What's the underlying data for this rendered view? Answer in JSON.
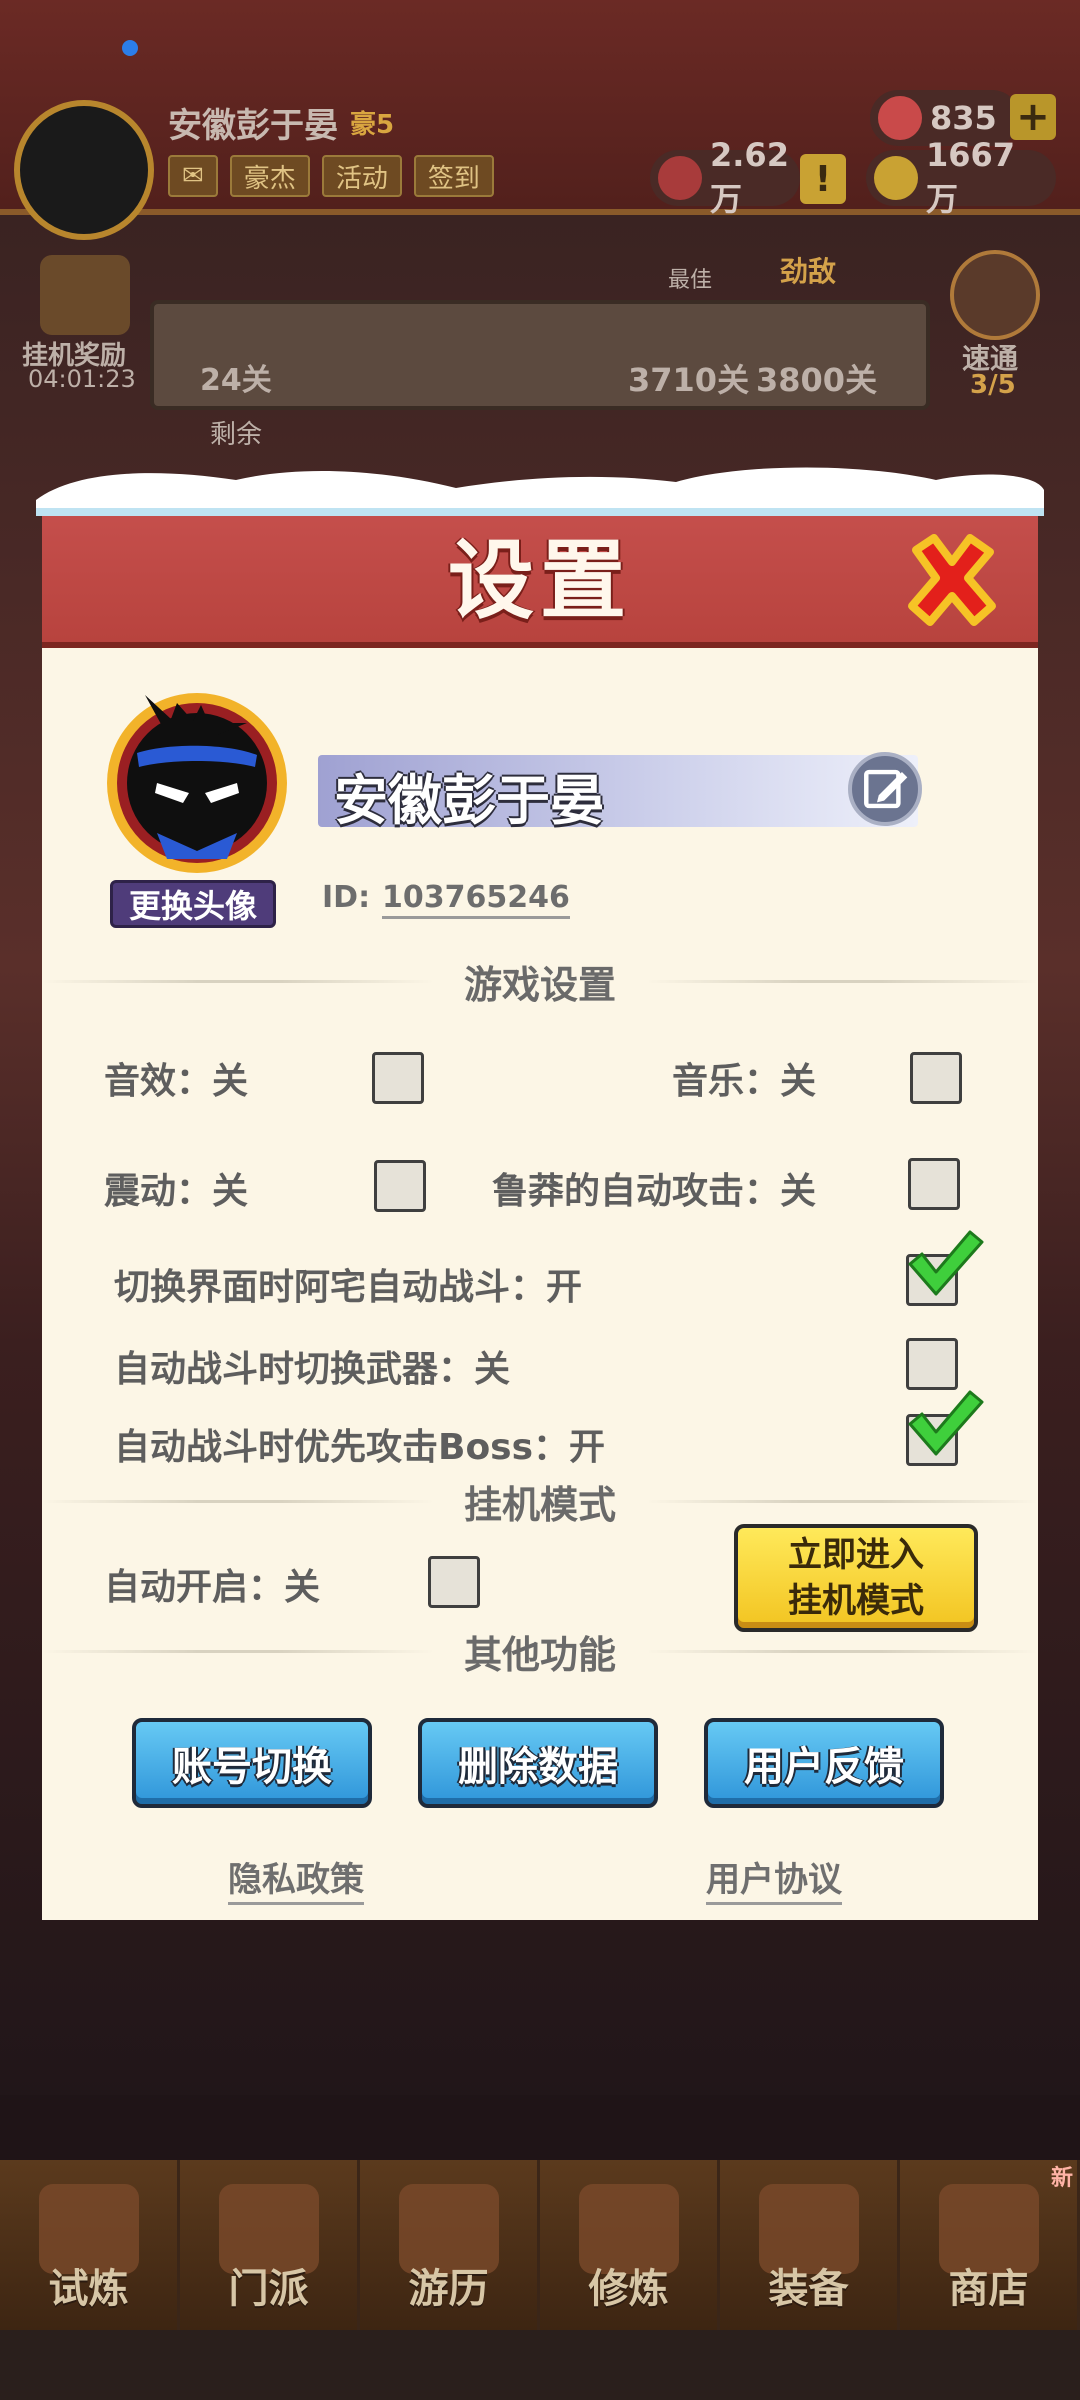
{
  "background": {
    "player_name": "安徽彭于晏",
    "rank": "豪5",
    "chips": [
      "豪杰",
      "活动",
      "签到"
    ],
    "gems": "835",
    "power": "2.62万",
    "coins": "1667万",
    "plus": "+",
    "warn": "!",
    "afk_label": "挂机奖励",
    "afk_timer": "04:01:23",
    "current_stage": "24关",
    "best_label": "最佳",
    "enemy_label": "劲敌",
    "best_stage": "3710关",
    "enemy_stage": "3800关",
    "sweep_label": "速通",
    "sweep_count": "3/5",
    "remaining_label": "剩余",
    "tabs": [
      {
        "label": "试炼"
      },
      {
        "label": "门派"
      },
      {
        "label": "游历"
      },
      {
        "label": "修炼"
      },
      {
        "label": "装备"
      },
      {
        "label": "商店"
      }
    ],
    "new_badge": "新"
  },
  "dialog": {
    "title": "设置",
    "close_icon": "close-x-icon",
    "profile": {
      "name": "安徽彭于晏",
      "change_avatar": "更换头像",
      "id_label": "ID:",
      "id_value": "103765246"
    },
    "game_settings": {
      "heading": "游戏设置",
      "sound": {
        "label": "音效：关",
        "checked": false
      },
      "music": {
        "label": "音乐：关",
        "checked": false
      },
      "vibration": {
        "label": "震动：关",
        "checked": false
      },
      "reckless_auto_attack": {
        "label": "鲁莽的自动攻击：关",
        "checked": false
      },
      "switch_screen_auto_battle": {
        "label": "切换界面时阿宅自动战斗：开",
        "checked": true
      },
      "auto_battle_switch_weapon": {
        "label": "自动战斗时切换武器：关",
        "checked": false
      },
      "auto_battle_priority_boss": {
        "label": "自动战斗时优先攻击Boss：开",
        "checked": true
      }
    },
    "afk_mode": {
      "heading": "挂机模式",
      "auto_start": {
        "label": "自动开启：关",
        "checked": false
      },
      "enter_button_line1": "立即进入",
      "enter_button_line2": "挂机模式"
    },
    "other": {
      "heading": "其他功能",
      "switch_account": "账号切换",
      "delete_data": "删除数据",
      "feedback": "用户反馈",
      "privacy": "隐私政策",
      "agreement": "用户协议"
    },
    "colors": {
      "header_red": "#c6504d",
      "body_cream": "#fcf6e6",
      "button_blue": "#2f95d9",
      "button_yellow": "#f2c421",
      "check_green": "#3fcf3c"
    }
  }
}
